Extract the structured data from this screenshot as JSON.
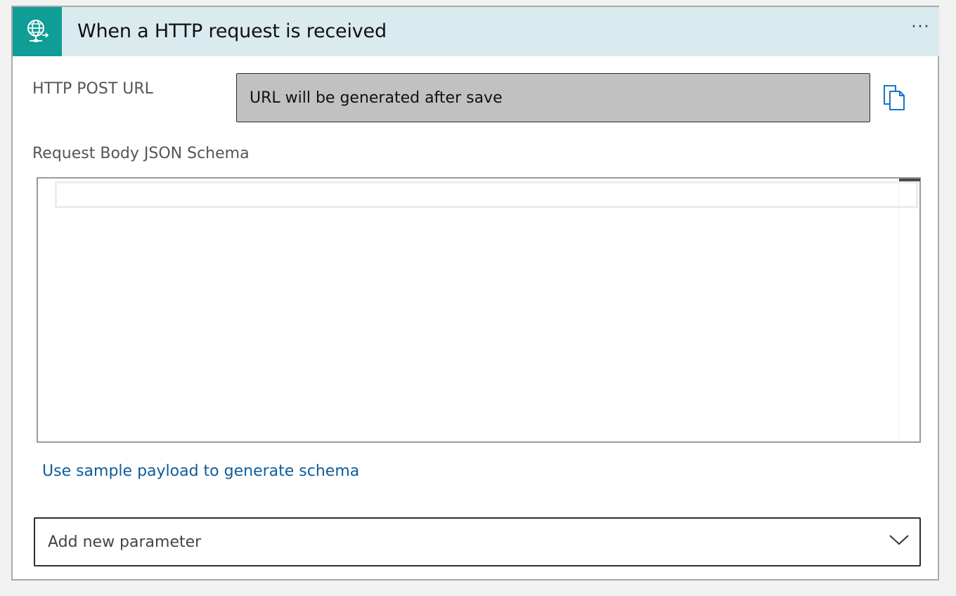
{
  "trigger": {
    "title": "When a HTTP request is received",
    "accent_color": "#0f9d95",
    "header_background": "#d9ebee",
    "icon": "globe-request-icon",
    "more_icon": "more-options-icon"
  },
  "fields": {
    "post_url_label": "HTTP POST URL",
    "post_url_value": "URL will be generated after save",
    "copy_icon": "copy-icon",
    "schema_label": "Request Body JSON Schema",
    "schema_value": ""
  },
  "actions": {
    "sample_payload_link": "Use sample payload to generate schema",
    "link_color": "#0f5c9b"
  },
  "add_parameter": {
    "placeholder": "Add new parameter",
    "chevron_icon": "chevron-down-icon"
  }
}
